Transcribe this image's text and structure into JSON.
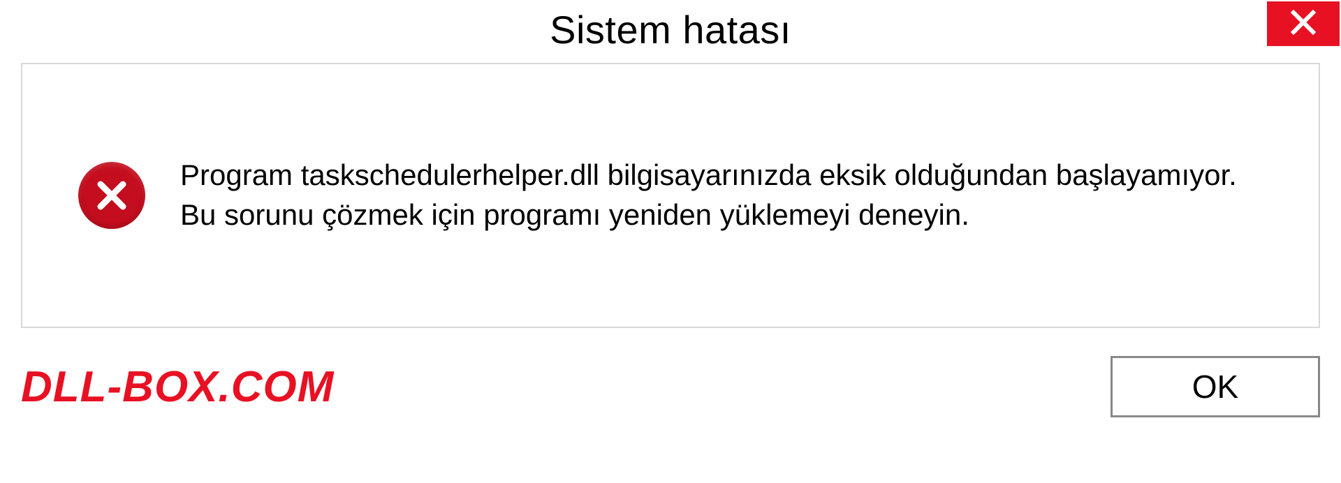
{
  "dialog": {
    "title": "Sistem hatası",
    "message": "Program taskschedulerhelper.dll bilgisayarınızda eksik olduğundan başlayamıyor. Bu sorunu çözmek için programı yeniden yüklemeyi deneyin.",
    "ok_label": "OK"
  },
  "watermark": "DLL-BOX.COM",
  "icons": {
    "close": "close-icon",
    "error": "error-icon"
  },
  "colors": {
    "close_bg": "#e81123",
    "error_bg": "#c40d1e",
    "watermark": "#e81123",
    "border": "#d8d8d8"
  }
}
